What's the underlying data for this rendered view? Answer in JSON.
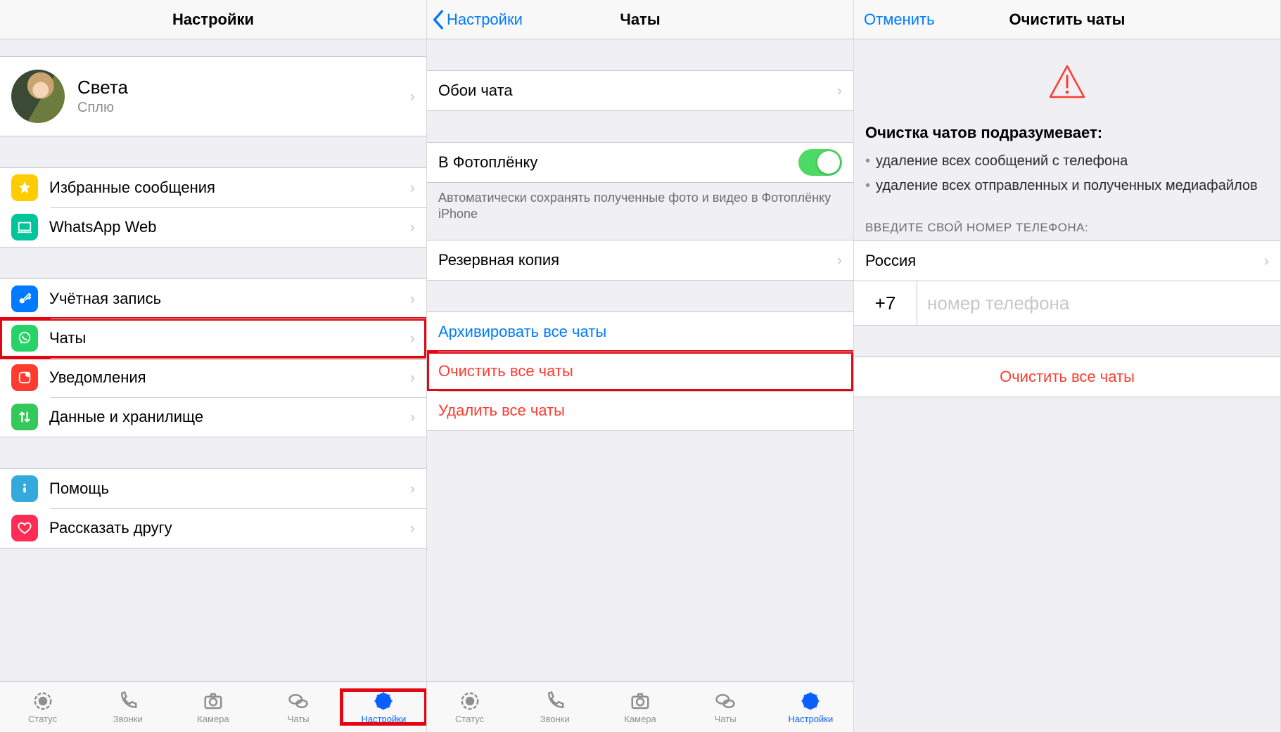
{
  "pane1": {
    "title": "Настройки",
    "profile": {
      "name": "Света",
      "status": "Сплю"
    },
    "group_a": [
      {
        "key": "starred",
        "label": "Избранные сообщения",
        "icon": "star-icon",
        "bg": "bg-yellow"
      },
      {
        "key": "web",
        "label": "WhatsApp Web",
        "icon": "laptop-icon",
        "bg": "bg-teal"
      }
    ],
    "group_b": [
      {
        "key": "account",
        "label": "Учётная запись",
        "icon": "key-icon",
        "bg": "bg-blue"
      },
      {
        "key": "chats",
        "label": "Чаты",
        "icon": "whatsapp-icon",
        "bg": "bg-green"
      },
      {
        "key": "notif",
        "label": "Уведомления",
        "icon": "notification-icon",
        "bg": "bg-red"
      },
      {
        "key": "data",
        "label": "Данные и хранилище",
        "icon": "transfer-icon",
        "bg": "bg-green2"
      }
    ],
    "group_c": [
      {
        "key": "help",
        "label": "Помощь",
        "icon": "info-icon",
        "bg": "bg-lblue"
      },
      {
        "key": "tell",
        "label": "Рассказать другу",
        "icon": "heart-icon",
        "bg": "bg-pink"
      }
    ]
  },
  "pane2": {
    "back": "Настройки",
    "title": "Чаты",
    "wallpaper": "Обои чата",
    "camera_roll": "В Фотоплёнку",
    "camera_roll_note": "Автоматически сохранять полученные фото и видео в Фотоплёнку iPhone",
    "backup": "Резервная копия",
    "archive_all": "Архивировать все чаты",
    "clear_all": "Очистить все чаты",
    "delete_all": "Удалить все чаты"
  },
  "pane3": {
    "cancel": "Отменить",
    "title": "Очистить чаты",
    "explain_title": "Очистка чатов подразумевает:",
    "bullet1": "удаление всех сообщений с телефона",
    "bullet2": "удаление всех отправленных и полученных медиафайлов",
    "enter_number_header": "ВВЕДИТЕ СВОЙ НОМЕР ТЕЛЕФОНА:",
    "country": "Россия",
    "prefix": "+7",
    "placeholder": "номер телефона",
    "clear_all": "Очистить все чаты"
  },
  "tabs": {
    "status": "Статус",
    "calls": "Звонки",
    "camera": "Камера",
    "chats": "Чаты",
    "settings": "Настройки"
  }
}
